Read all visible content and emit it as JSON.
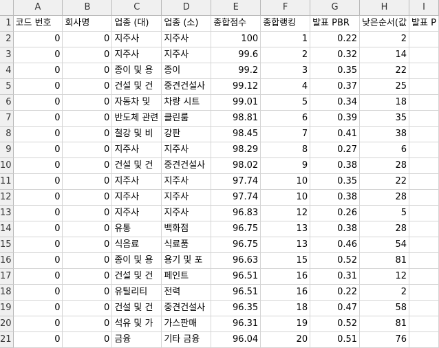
{
  "column_letters": [
    "A",
    "B",
    "C",
    "D",
    "E",
    "F",
    "G",
    "H",
    "I"
  ],
  "header_row": {
    "row_number": "1",
    "cells": [
      "코드 번호",
      "회사명",
      "업종 (대)",
      "업종 (소)",
      "종합점수",
      "종합랭킹",
      "발표 PBR",
      "낮은순서(값",
      "발표 P"
    ]
  },
  "rows": [
    {
      "n": "2",
      "a": "0",
      "b": "0",
      "c": "지주사",
      "d": "지주사",
      "e": "100",
      "f": "1",
      "g": "0.22",
      "h": "2"
    },
    {
      "n": "3",
      "a": "0",
      "b": "0",
      "c": "지주사",
      "d": "지주사",
      "e": "99.6",
      "f": "2",
      "g": "0.32",
      "h": "14"
    },
    {
      "n": "4",
      "a": "0",
      "b": "0",
      "c": "종이 및 용",
      "d": "종이",
      "e": "99.2",
      "f": "3",
      "g": "0.35",
      "h": "22"
    },
    {
      "n": "5",
      "a": "0",
      "b": "0",
      "c": "건설 및 건",
      "d": "중견건설사",
      "e": "99.12",
      "f": "4",
      "g": "0.37",
      "h": "25"
    },
    {
      "n": "6",
      "a": "0",
      "b": "0",
      "c": "자동차 및",
      "d": "차량 시트",
      "e": "99.01",
      "f": "5",
      "g": "0.34",
      "h": "18"
    },
    {
      "n": "7",
      "a": "0",
      "b": "0",
      "c": "반도체 관련",
      "d": "클린룸",
      "e": "98.81",
      "f": "6",
      "g": "0.39",
      "h": "35"
    },
    {
      "n": "8",
      "a": "0",
      "b": "0",
      "c": "철강 및 비",
      "d": "강판",
      "e": "98.45",
      "f": "7",
      "g": "0.41",
      "h": "38"
    },
    {
      "n": "9",
      "a": "0",
      "b": "0",
      "c": "지주사",
      "d": "지주사",
      "e": "98.29",
      "f": "8",
      "g": "0.27",
      "h": "6"
    },
    {
      "n": "10",
      "a": "0",
      "b": "0",
      "c": "건설 및 건",
      "d": "중견건설사",
      "e": "98.02",
      "f": "9",
      "g": "0.38",
      "h": "28"
    },
    {
      "n": "11",
      "a": "0",
      "b": "0",
      "c": "지주사",
      "d": "지주사",
      "e": "97.74",
      "f": "10",
      "g": "0.35",
      "h": "22"
    },
    {
      "n": "12",
      "a": "0",
      "b": "0",
      "c": "지주사",
      "d": "지주사",
      "e": "97.74",
      "f": "10",
      "g": "0.38",
      "h": "28"
    },
    {
      "n": "13",
      "a": "0",
      "b": "0",
      "c": "지주사",
      "d": "지주사",
      "e": "96.83",
      "f": "12",
      "g": "0.26",
      "h": "5"
    },
    {
      "n": "14",
      "a": "0",
      "b": "0",
      "c": "유통",
      "d": "백화점",
      "e": "96.75",
      "f": "13",
      "g": "0.38",
      "h": "28"
    },
    {
      "n": "15",
      "a": "0",
      "b": "0",
      "c": "식음료",
      "d": "식료품",
      "e": "96.75",
      "f": "13",
      "g": "0.46",
      "h": "54"
    },
    {
      "n": "16",
      "a": "0",
      "b": "0",
      "c": "종이 및 용",
      "d": "용기 및 포",
      "e": "96.63",
      "f": "15",
      "g": "0.52",
      "h": "81"
    },
    {
      "n": "17",
      "a": "0",
      "b": "0",
      "c": "건설 및 건",
      "d": "페인트",
      "e": "96.51",
      "f": "16",
      "g": "0.31",
      "h": "12"
    },
    {
      "n": "18",
      "a": "0",
      "b": "0",
      "c": "유틸리티",
      "d": "전력",
      "e": "96.51",
      "f": "16",
      "g": "0.22",
      "h": "2"
    },
    {
      "n": "19",
      "a": "0",
      "b": "0",
      "c": "건설 및 건",
      "d": "중견건설사",
      "e": "96.35",
      "f": "18",
      "g": "0.47",
      "h": "58"
    },
    {
      "n": "20",
      "a": "0",
      "b": "0",
      "c": "석유 및 가",
      "d": "가스판매",
      "e": "96.31",
      "f": "19",
      "g": "0.52",
      "h": "81"
    },
    {
      "n": "21",
      "a": "0",
      "b": "0",
      "c": "금융",
      "d": "기타 금융",
      "e": "96.04",
      "f": "20",
      "g": "0.51",
      "h": "76"
    }
  ]
}
